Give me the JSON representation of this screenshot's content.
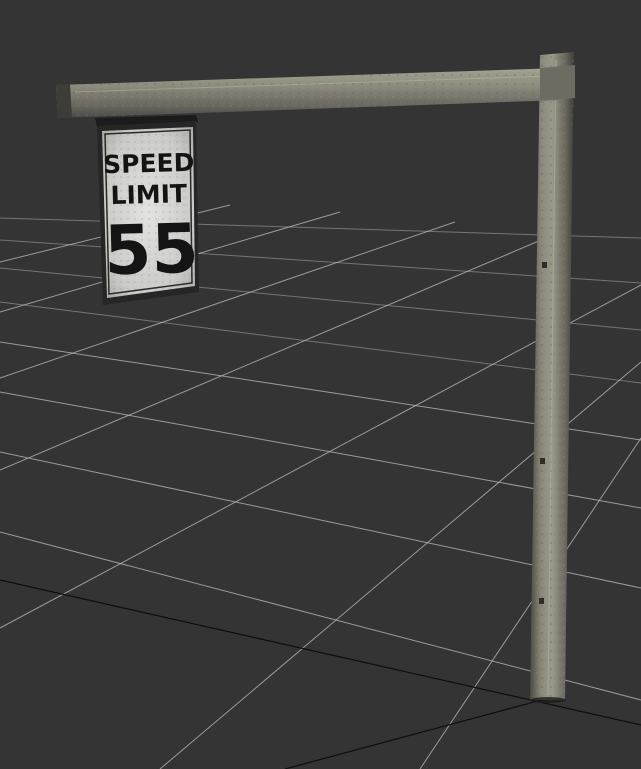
{
  "scene": {
    "background_color": "#343434",
    "grid_color_near": "#bdbdbd",
    "grid_color_far": "#8a8a8a",
    "grid_color_black": "#0e0e0e",
    "pole_color": "#7d7c73",
    "arm_color": "#8a8878"
  },
  "sign": {
    "line1": "SPEED",
    "line2": "LIMIT",
    "speed": "55",
    "face_color": "#d9d9d6",
    "border_color": "#1a1a1a",
    "text_color": "#141414"
  },
  "objects": {
    "pole_name": "sign-pole",
    "arm_name": "sign-arm"
  }
}
